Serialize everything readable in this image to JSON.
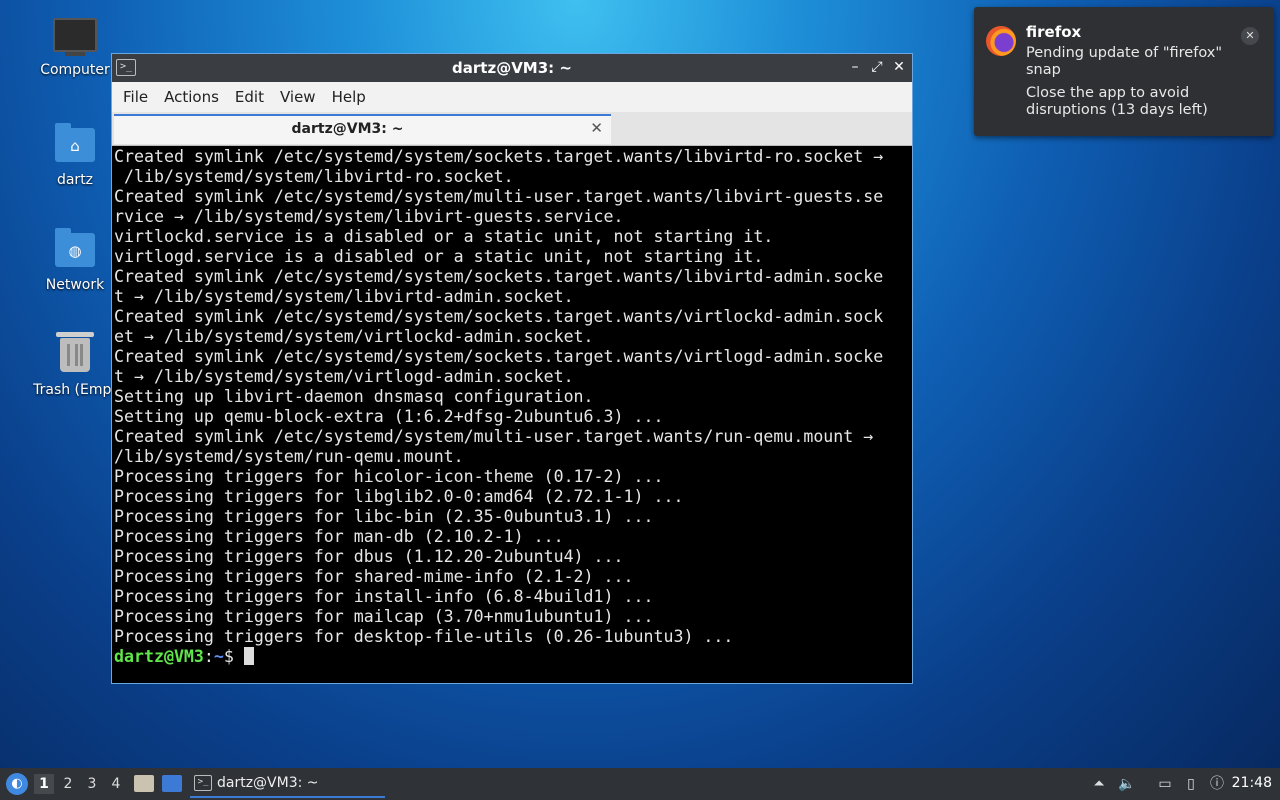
{
  "desktop": {
    "icons": [
      {
        "label": "Computer"
      },
      {
        "label": "dartz"
      },
      {
        "label": "Network"
      },
      {
        "label": "Trash (Empt"
      }
    ]
  },
  "terminal": {
    "title": "dartz@VM3: ~",
    "menu": [
      "File",
      "Actions",
      "Edit",
      "View",
      "Help"
    ],
    "tab_title": "dartz@VM3: ~",
    "lines": [
      "Created symlink /etc/systemd/system/sockets.target.wants/libvirtd-ro.socket →",
      " /lib/systemd/system/libvirtd-ro.socket.",
      "Created symlink /etc/systemd/system/multi-user.target.wants/libvirt-guests.se",
      "rvice → /lib/systemd/system/libvirt-guests.service.",
      "virtlockd.service is a disabled or a static unit, not starting it.",
      "virtlogd.service is a disabled or a static unit, not starting it.",
      "Created symlink /etc/systemd/system/sockets.target.wants/libvirtd-admin.socke",
      "t → /lib/systemd/system/libvirtd-admin.socket.",
      "Created symlink /etc/systemd/system/sockets.target.wants/virtlockd-admin.sock",
      "et → /lib/systemd/system/virtlockd-admin.socket.",
      "Created symlink /etc/systemd/system/sockets.target.wants/virtlogd-admin.socke",
      "t → /lib/systemd/system/virtlogd-admin.socket.",
      "Setting up libvirt-daemon dnsmasq configuration.",
      "Setting up qemu-block-extra (1:6.2+dfsg-2ubuntu6.3) ...",
      "Created symlink /etc/systemd/system/multi-user.target.wants/run-qemu.mount →",
      "/lib/systemd/system/run-qemu.mount.",
      "Processing triggers for hicolor-icon-theme (0.17-2) ...",
      "Processing triggers for libglib2.0-0:amd64 (2.72.1-1) ...",
      "Processing triggers for libc-bin (2.35-0ubuntu3.1) ...",
      "Processing triggers for man-db (2.10.2-1) ...",
      "Processing triggers for dbus (1.12.20-2ubuntu4) ...",
      "Processing triggers for shared-mime-info (2.1-2) ...",
      "Processing triggers for install-info (6.8-4build1) ...",
      "Processing triggers for mailcap (3.70+nmu1ubuntu1) ...",
      "Processing triggers for desktop-file-utils (0.26-1ubuntu3) ..."
    ],
    "prompt": {
      "user_host": "dartz@VM3",
      "sep": ":",
      "path": "~",
      "symbol": "$ "
    }
  },
  "notification": {
    "app": "firefox",
    "line1": "Pending update of \"firefox\" snap",
    "line2": "Close the app to avoid disruptions (13 days left)"
  },
  "taskbar": {
    "workspaces": [
      "1",
      "2",
      "3",
      "4"
    ],
    "task_label": "dartz@VM3: ~",
    "clock": "21:48"
  }
}
